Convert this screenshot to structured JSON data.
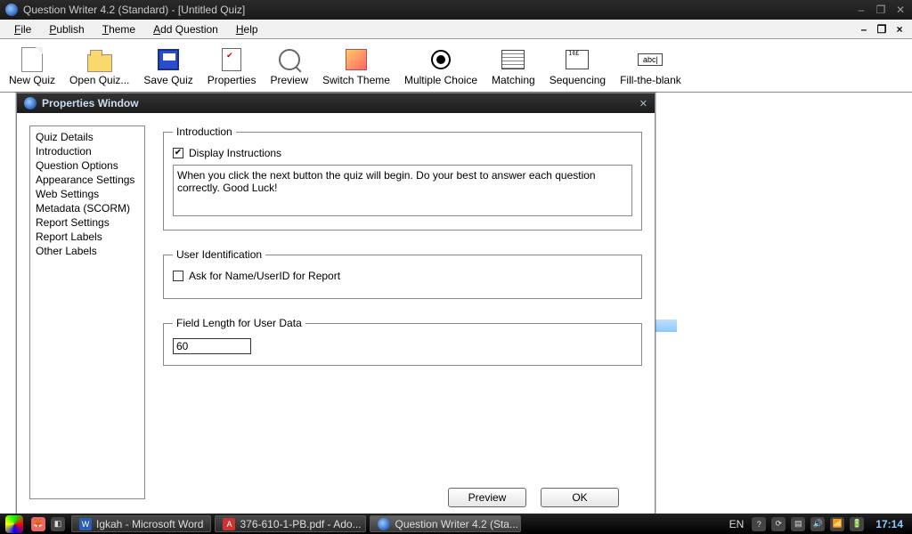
{
  "window": {
    "title": "Question Writer 4.2 (Standard) - [Untitled Quiz]"
  },
  "menu": {
    "file": "File",
    "publish": "Publish",
    "theme": "Theme",
    "add_question": "Add Question",
    "help": "Help"
  },
  "toolbar": {
    "new_quiz": "New Quiz",
    "open_quiz": "Open Quiz...",
    "save_quiz": "Save Quiz",
    "properties": "Properties",
    "preview": "Preview",
    "switch_theme": "Switch Theme",
    "multiple_choice": "Multiple Choice",
    "matching": "Matching",
    "sequencing": "Sequencing",
    "fill_the_blank": "Fill-the-blank",
    "fill_icon_text": "abc|"
  },
  "dialog": {
    "title": "Properties Window",
    "nav": {
      "quiz_details": "Quiz Details",
      "introduction": "Introduction",
      "question_options": "Question Options",
      "appearance_settings": "Appearance Settings",
      "web_settings": "Web Settings",
      "metadata_scorm": "Metadata (SCORM)",
      "report_settings": "Report Settings",
      "report_labels": "Report Labels",
      "other_labels": "Other Labels"
    },
    "introduction": {
      "legend": "Introduction",
      "display_instructions_label": "Display Instructions",
      "display_instructions_checked": true,
      "instructions_text": "When you click the next button the quiz will begin. Do your best to answer each question correctly. Good Luck!"
    },
    "user_identification": {
      "legend": "User Identification",
      "ask_label": "Ask for Name/UserID for Report",
      "ask_checked": false
    },
    "field_length": {
      "legend": "Field Length for User Data",
      "value": "60"
    },
    "buttons": {
      "preview": "Preview",
      "ok": "OK"
    }
  },
  "taskbar": {
    "tasks": {
      "word": "Igkah - Microsoft Word",
      "pdf": "376-610-1-PB.pdf - Ado...",
      "qw": "Question Writer 4.2 (Sta..."
    },
    "lang": "EN",
    "clock": "17:14"
  }
}
